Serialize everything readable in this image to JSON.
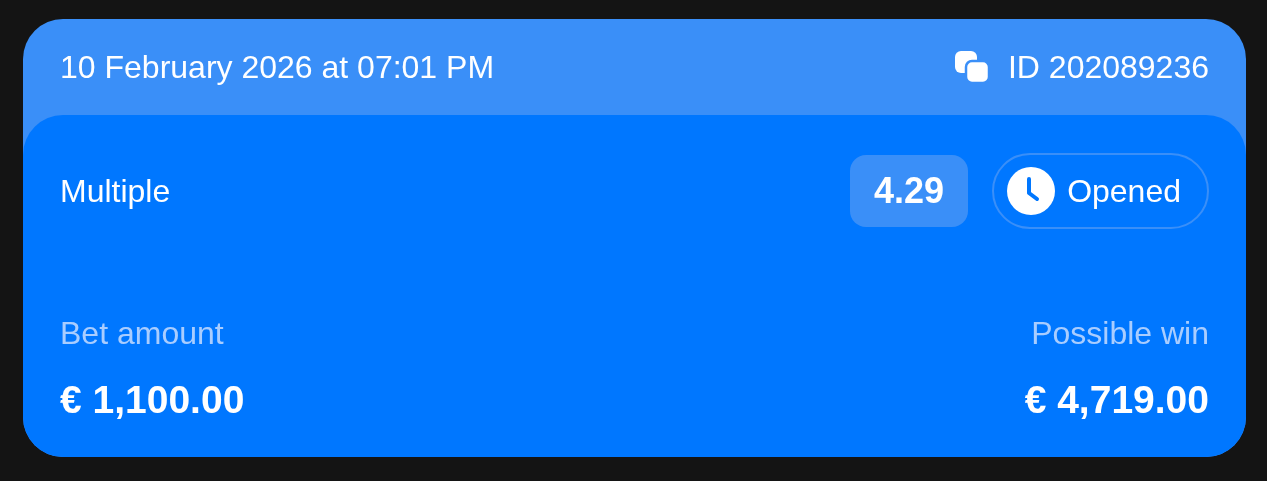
{
  "header": {
    "date": "10 February 2026 at 07:01 PM",
    "id": "ID 202089236"
  },
  "bet": {
    "type": "Multiple",
    "odds": "4.29",
    "status": "Opened"
  },
  "amounts": [
    {
      "label": "Bet amount",
      "value": "€ 1,100.00"
    },
    {
      "label": "Possible win",
      "value": "€ 4,719.00"
    }
  ]
}
